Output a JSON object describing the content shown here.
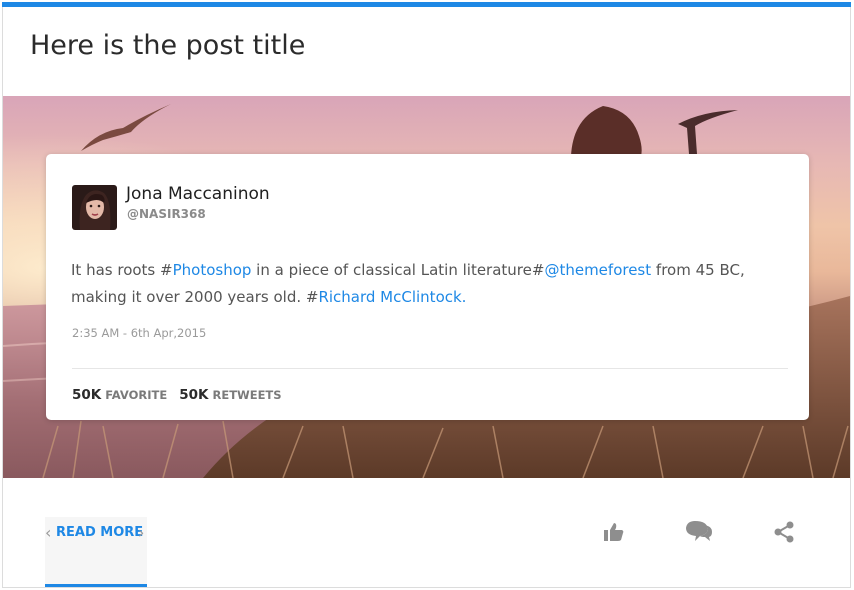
{
  "post": {
    "title": "Here is the post title"
  },
  "tweet": {
    "user_name": "Jona Maccaninon",
    "user_handle": "@NASIR368",
    "text_parts": {
      "p1": "It has roots #",
      "link1": "Photoshop",
      "p2": " in a piece of classical Latin literature#",
      "link2": "@themeforest",
      "p3": " from 45 BC,",
      "p4": "making it over 2000 years old. #",
      "link3": "Richard McClintock."
    },
    "timestamp": "2:35 AM - 6th Apr,2015",
    "favorites_count": "50K",
    "favorites_label": "FAVORITE",
    "retweets_count": "50K",
    "retweets_label": "RETWEETS"
  },
  "footer": {
    "read_more_label": "READ MORE",
    "actions": [
      {
        "name": "like",
        "icon": "thumbs-up-icon"
      },
      {
        "name": "comment",
        "icon": "speech-bubbles-icon"
      },
      {
        "name": "share",
        "icon": "share-icon"
      }
    ]
  },
  "colors": {
    "accent": "#1e88e5",
    "title_text": "#2b2b2b",
    "icon_gray": "#8e8e8e"
  }
}
